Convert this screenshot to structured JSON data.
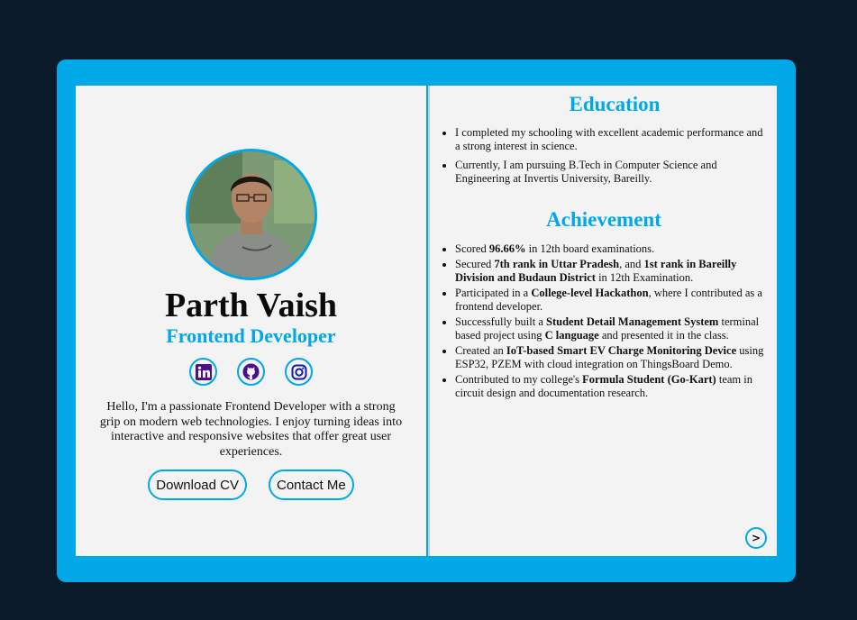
{
  "profile": {
    "name": "Parth Vaish",
    "role": "Frontend Developer",
    "bio": "Hello, I'm a passionate Frontend Developer with a strong grip on modern web technologies. I enjoy turning ideas into interactive and responsive websites that offer great user experiences.",
    "socials": [
      {
        "icon": "linkedin-icon",
        "color": "#4a0f8a"
      },
      {
        "icon": "github-icon",
        "color": "#4a0f8a"
      },
      {
        "icon": "instagram-icon",
        "color": "#1a1aa8"
      }
    ],
    "buttons": {
      "download": "Download CV",
      "contact": "Contact Me"
    }
  },
  "education": {
    "title": "Education",
    "items": [
      "I completed my schooling with excellent academic performance and a strong interest in science.",
      "Currently, I am pursuing B.Tech in Computer Science and Engineering at Invertis University, Bareilly."
    ]
  },
  "achievement": {
    "title": "Achievement",
    "items": [
      [
        {
          "t": "Scored "
        },
        {
          "t": "96.66%",
          "b": true
        },
        {
          "t": " in 12th board examinations."
        }
      ],
      [
        {
          "t": "Secured "
        },
        {
          "t": "7th rank in Uttar Pradesh",
          "b": true
        },
        {
          "t": ", and "
        },
        {
          "t": "1st rank in Bareilly Division and Budaun District",
          "b": true
        },
        {
          "t": " in 12th Examination."
        }
      ],
      [
        {
          "t": "Participated in a "
        },
        {
          "t": "College-level Hackathon",
          "b": true
        },
        {
          "t": ", where I contributed as a frontend developer."
        }
      ],
      [
        {
          "t": "Successfully built a "
        },
        {
          "t": "Student Detail Management System",
          "b": true
        },
        {
          "t": " terminal based project using "
        },
        {
          "t": "C language",
          "b": true
        },
        {
          "t": " and presented it in the class."
        }
      ],
      [
        {
          "t": "Created an "
        },
        {
          "t": "IoT-based Smart EV Charge Monitoring Device",
          "b": true
        },
        {
          "t": " using ESP32, PZEM with cloud integration on ThingsBoard Demo."
        }
      ],
      [
        {
          "t": "Contributed to my college's "
        },
        {
          "t": "Formula Student (Go-Kart)",
          "b": true
        },
        {
          "t": " team in circuit design and documentation research."
        }
      ]
    ]
  },
  "nav": {
    "next_label": ">"
  },
  "colors": {
    "accent": "#00a8e8",
    "background": "#0a1a28",
    "page": "#f3f3f3"
  }
}
